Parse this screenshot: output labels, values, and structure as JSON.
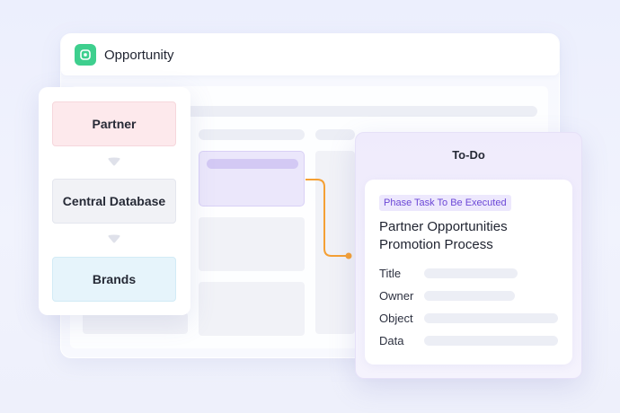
{
  "window": {
    "title": "Opportunity"
  },
  "flow": {
    "steps": [
      "Partner",
      "Central Database",
      "Brands"
    ]
  },
  "todo": {
    "header": "To-Do",
    "badge": "Phase Task To Be Executed",
    "process_title": "Partner Opportunities Promotion Process",
    "fields": [
      "Title",
      "Owner",
      "Object",
      "Data"
    ]
  },
  "colors": {
    "app_icon": "#3ecf8e",
    "connector": "#f5a034",
    "badge_text": "#6b47d6",
    "partner_box": "#fde9ec",
    "brands_box": "#e6f4fb"
  },
  "icons": {
    "app": "square-app-icon",
    "step_arrow": "triangle-down-icon"
  }
}
